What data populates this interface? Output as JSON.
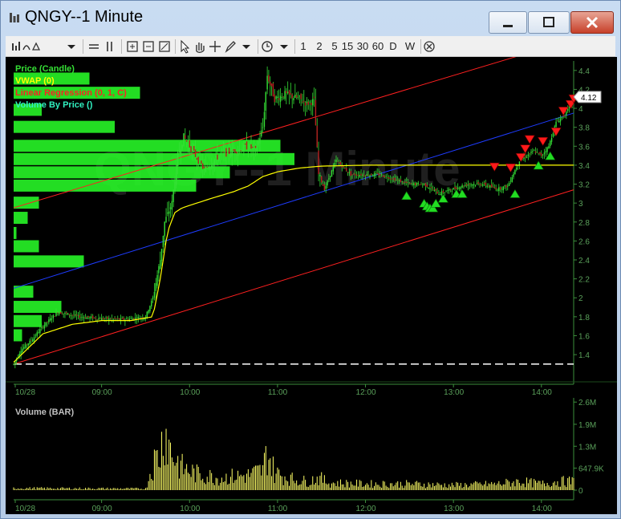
{
  "window": {
    "title": "QNGY--1 Minute"
  },
  "toolbar": {
    "intervals": [
      "1",
      "2",
      "5",
      "15",
      "30",
      "60",
      "D",
      "W"
    ]
  },
  "colors": {
    "candle": "#35e035",
    "vwap": "#ffff00",
    "regression": "#ff2020",
    "regression_mid": "#1e3cff",
    "vbp": "#27f527",
    "volume": "#ffff66",
    "axis": "#3c8f3c",
    "buy_marker": "#22dd22",
    "sell_marker": "#ff1a1a"
  },
  "chart_data": [
    {
      "type": "candlestick",
      "watermark": "QNGY--1 Minute",
      "legend": [
        {
          "label": "Price (Candle)",
          "color": "#35e035"
        },
        {
          "label": "VWAP (0)",
          "color": "#ffff00"
        },
        {
          "label": "Linear Regression (0, 1, C)",
          "color": "#ff2020"
        },
        {
          "label": "Volume By Price ()",
          "color": "#30f0c0"
        }
      ],
      "legend_position": "top-left",
      "y_ticks": [
        4.4,
        4.2,
        4,
        3.8,
        3.6,
        3.4,
        3.2,
        3,
        2.8,
        2.6,
        2.4,
        2.2,
        2,
        1.8,
        1.6,
        1.4
      ],
      "y_tick_labels": [
        "4.4",
        "4.2",
        "4",
        "3.8",
        "3.6",
        "3.4",
        "3.2",
        "3",
        "2.8",
        "2.6",
        "2.4",
        "2.2",
        "2",
        "1.8",
        "1.6",
        "1.4"
      ],
      "ylim": [
        1.24,
        4.5
      ],
      "x_tick_labels": [
        "10/28",
        "09:00",
        "10:00",
        "11:00",
        "12:00",
        "13:00",
        "14:00"
      ],
      "x_tick_minutes": [
        0,
        60,
        120,
        180,
        240,
        300,
        360
      ],
      "session_start": "08:30",
      "last_price": 4.12,
      "last_price_label": "4.12",
      "price_keypoints": [
        [
          0,
          1.3
        ],
        [
          5,
          1.45
        ],
        [
          12,
          1.55
        ],
        [
          20,
          1.7
        ],
        [
          30,
          1.85
        ],
        [
          45,
          1.8
        ],
        [
          60,
          1.78
        ],
        [
          75,
          1.77
        ],
        [
          90,
          1.8
        ],
        [
          95,
          2.0
        ],
        [
          100,
          2.4
        ],
        [
          103,
          2.8
        ],
        [
          108,
          3.0
        ],
        [
          112,
          3.5
        ],
        [
          116,
          3.7
        ],
        [
          122,
          3.55
        ],
        [
          130,
          3.35
        ],
        [
          140,
          3.5
        ],
        [
          150,
          3.55
        ],
        [
          160,
          3.6
        ],
        [
          165,
          3.55
        ],
        [
          170,
          3.8
        ],
        [
          173,
          4.35
        ],
        [
          178,
          4.1
        ],
        [
          185,
          4.15
        ],
        [
          195,
          4.1
        ],
        [
          200,
          4.05
        ],
        [
          205,
          4.08
        ],
        [
          208,
          3.3
        ],
        [
          212,
          3.15
        ],
        [
          220,
          3.45
        ],
        [
          230,
          3.3
        ],
        [
          240,
          3.3
        ],
        [
          250,
          3.3
        ],
        [
          260,
          3.25
        ],
        [
          270,
          3.2
        ],
        [
          280,
          3.2
        ],
        [
          290,
          3.1
        ],
        [
          300,
          3.15
        ],
        [
          310,
          3.2
        ],
        [
          320,
          3.2
        ],
        [
          330,
          3.15
        ],
        [
          337,
          3.18
        ],
        [
          345,
          3.45
        ],
        [
          350,
          3.5
        ],
        [
          355,
          3.55
        ],
        [
          360,
          3.5
        ],
        [
          365,
          3.6
        ],
        [
          370,
          3.85
        ],
        [
          377,
          3.95
        ],
        [
          382,
          4.12
        ]
      ],
      "vwap_keypoints": [
        [
          0,
          1.32
        ],
        [
          20,
          1.62
        ],
        [
          40,
          1.72
        ],
        [
          60,
          1.76
        ],
        [
          80,
          1.76
        ],
        [
          95,
          1.8
        ],
        [
          100,
          2.2
        ],
        [
          105,
          2.7
        ],
        [
          110,
          2.9
        ],
        [
          115,
          2.95
        ],
        [
          125,
          3.0
        ],
        [
          135,
          3.05
        ],
        [
          150,
          3.12
        ],
        [
          160,
          3.18
        ],
        [
          170,
          3.28
        ],
        [
          180,
          3.33
        ],
        [
          195,
          3.37
        ],
        [
          210,
          3.39
        ],
        [
          240,
          3.4
        ],
        [
          300,
          3.4
        ],
        [
          340,
          3.4
        ],
        [
          360,
          3.4
        ],
        [
          382,
          3.4
        ]
      ],
      "regression_upper": [
        [
          0,
          2.95
        ],
        [
          350,
          4.58
        ]
      ],
      "regression_mid": [
        [
          0,
          2.1
        ],
        [
          382,
          3.95
        ]
      ],
      "regression_lower": [
        [
          0,
          1.3
        ],
        [
          382,
          3.14
        ]
      ],
      "dashed_level": 1.3,
      "buy_markers": [
        [
          268,
          3.13
        ],
        [
          280,
          3.05
        ],
        [
          282,
          3.02
        ],
        [
          284,
          3.0
        ],
        [
          286,
          3.0
        ],
        [
          288,
          3.05
        ],
        [
          293,
          3.1
        ],
        [
          302,
          3.15
        ],
        [
          306,
          3.15
        ],
        [
          342,
          3.15
        ],
        [
          358,
          3.45
        ],
        [
          366,
          3.55
        ]
      ],
      "sell_markers": [
        [
          328,
          3.33
        ],
        [
          339,
          3.32
        ],
        [
          346,
          3.43
        ],
        [
          349,
          3.52
        ],
        [
          352,
          3.62
        ],
        [
          361,
          3.6
        ],
        [
          370,
          3.7
        ],
        [
          375,
          3.92
        ],
        [
          380,
          3.99
        ],
        [
          382,
          4.05
        ]
      ],
      "volume_by_price": [
        {
          "price": 4.31,
          "width": 0.27
        },
        {
          "price": 4.16,
          "width": 0.45
        },
        {
          "price": 3.98,
          "width": 0.1
        },
        {
          "price": 3.8,
          "width": 0.36
        },
        {
          "price": 3.6,
          "width": 0.95
        },
        {
          "price": 3.46,
          "width": 1.0
        },
        {
          "price": 3.32,
          "width": 0.77
        },
        {
          "price": 3.18,
          "width": 0.65
        },
        {
          "price": 3.0,
          "width": 0.09
        },
        {
          "price": 2.84,
          "width": 0.05
        },
        {
          "price": 2.68,
          "width": 0.01
        },
        {
          "price": 2.54,
          "width": 0.09
        },
        {
          "price": 2.38,
          "width": 0.25
        },
        {
          "price": 2.06,
          "width": 0.07
        },
        {
          "price": 1.9,
          "width": 0.17
        },
        {
          "price": 1.75,
          "width": 0.1
        },
        {
          "price": 1.6,
          "width": 0.03
        }
      ]
    },
    {
      "type": "bar",
      "title": "Volume (BAR)",
      "y_tick_labels": [
        "2.6M",
        "1.9M",
        "1.3M",
        "647.9K",
        "0"
      ],
      "y_ticks": [
        2600000,
        1943700,
        1295800,
        647900,
        0
      ],
      "ylim": [
        0,
        2700000
      ],
      "x_tick_labels": [
        "10/28",
        "09:00",
        "10:00",
        "11:00",
        "12:00",
        "13:00",
        "14:00"
      ],
      "volume_keypoints": [
        [
          0,
          80000
        ],
        [
          90,
          60000
        ],
        [
          95,
          1100000
        ],
        [
          100,
          1500000
        ],
        [
          103,
          2600000
        ],
        [
          106,
          1800000
        ],
        [
          110,
          1300000
        ],
        [
          115,
          900000
        ],
        [
          125,
          650000
        ],
        [
          140,
          500000
        ],
        [
          160,
          600000
        ],
        [
          170,
          800000
        ],
        [
          173,
          1600000
        ],
        [
          178,
          700000
        ],
        [
          190,
          450000
        ],
        [
          200,
          350000
        ],
        [
          208,
          500000
        ],
        [
          215,
          300000
        ],
        [
          240,
          250000
        ],
        [
          270,
          250000
        ],
        [
          300,
          200000
        ],
        [
          330,
          250000
        ],
        [
          345,
          350000
        ],
        [
          360,
          250000
        ],
        [
          370,
          350000
        ],
        [
          382,
          350000
        ]
      ]
    }
  ]
}
